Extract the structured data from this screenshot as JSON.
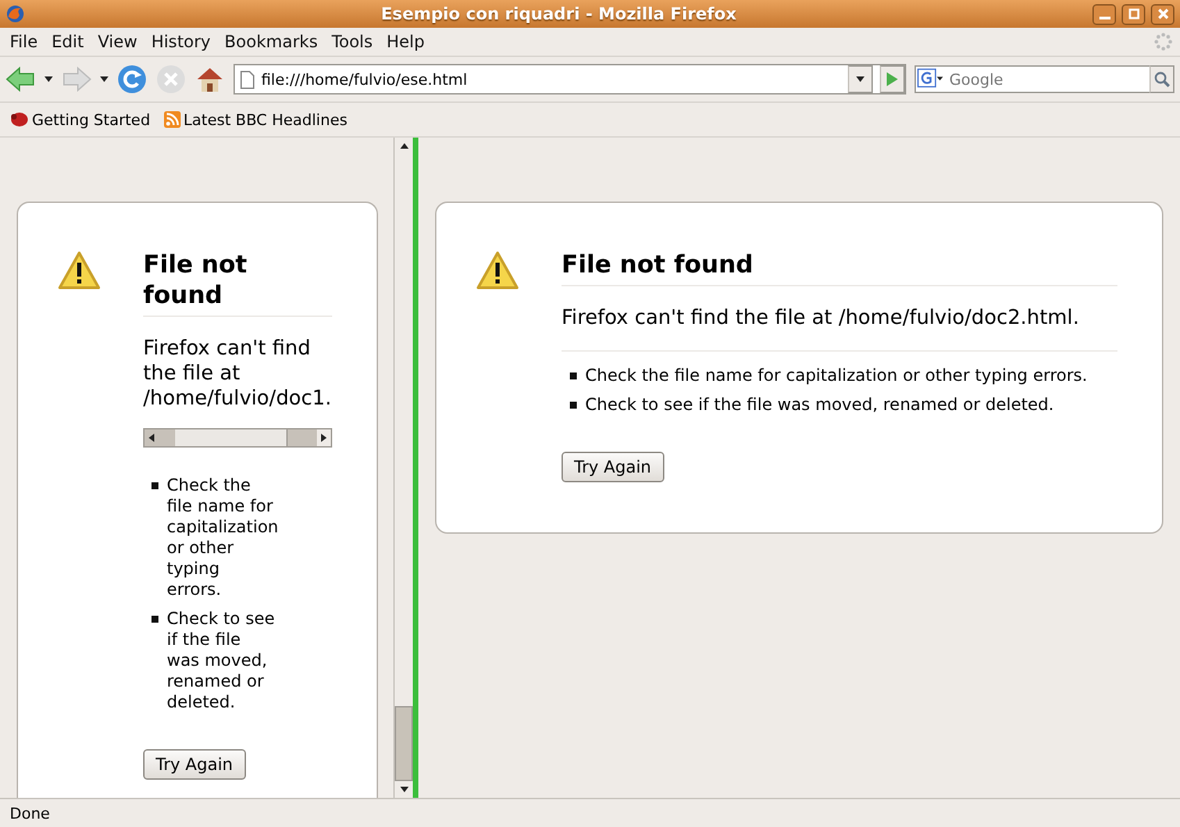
{
  "window": {
    "title": "Esempio con riquadri - Mozilla Firefox"
  },
  "menu": [
    "File",
    "Edit",
    "View",
    "History",
    "Bookmarks",
    "Tools",
    "Help"
  ],
  "address": {
    "value": "file:///home/fulvio/ese.html"
  },
  "search": {
    "placeholder": "Google"
  },
  "bookmarks": [
    {
      "label": "Getting Started",
      "kind": "bug"
    },
    {
      "label": "Latest BBC Headlines",
      "kind": "feed"
    }
  ],
  "frames": [
    {
      "title": "File not found",
      "message": "Firefox can't find the file at /home/fulvio/doc1.",
      "bullets": [
        "Check the file name for capitalization or other typing errors.",
        "Check to see if the file was moved, renamed or deleted."
      ],
      "button": "Try Again",
      "narrow": true
    },
    {
      "title": "File not found",
      "message": "Firefox can't find the file at /home/fulvio/doc2.html.",
      "bullets": [
        "Check the file name for capitalization or other typing errors.",
        "Check to see if the file was moved, renamed or deleted."
      ],
      "button": "Try Again",
      "narrow": false
    }
  ],
  "status_bar": "Done"
}
